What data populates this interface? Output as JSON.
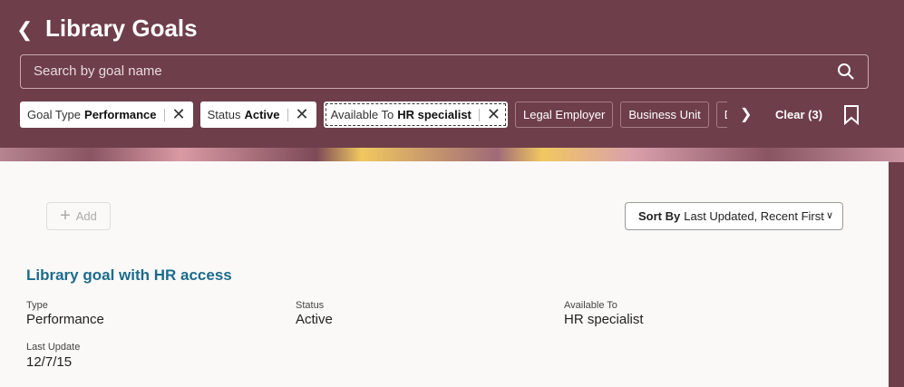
{
  "header": {
    "title": "Library Goals",
    "search_placeholder": "Search by goal name"
  },
  "filters": [
    {
      "label": "Goal Type",
      "value": "Performance"
    },
    {
      "label": "Status",
      "value": "Active"
    },
    {
      "label": "Available To",
      "value": "HR specialist"
    }
  ],
  "filter_options": [
    "Legal Employer",
    "Business Unit",
    "Departm"
  ],
  "clear_label": "Clear (3)",
  "toolbar": {
    "add_label": "Add",
    "sort_prefix": "Sort By",
    "sort_value": "Last Updated, Recent First"
  },
  "goal": {
    "title": "Library goal with HR access",
    "fields": [
      {
        "label": "Type",
        "value": "Performance"
      },
      {
        "label": "Status",
        "value": "Active"
      },
      {
        "label": "Available To",
        "value": "HR specialist"
      },
      {
        "label": "Last Update",
        "value": "12/7/15"
      }
    ]
  },
  "colors": {
    "header": "#6e3e4a",
    "link": "#1c6b8c"
  }
}
